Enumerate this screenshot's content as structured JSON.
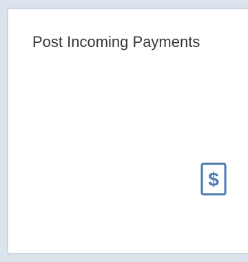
{
  "tile": {
    "title": "Post Incoming Payments",
    "icon": "dollar-document-icon",
    "accent_color": "#4a7ab2"
  }
}
